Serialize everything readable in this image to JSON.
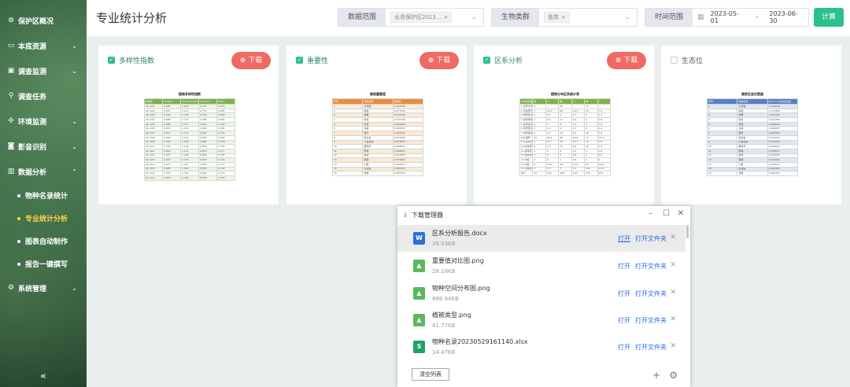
{
  "sidebar": {
    "items": [
      {
        "icon": "shield-icon",
        "glyph": "⊙",
        "label": "保护区概况",
        "chevron": false
      },
      {
        "icon": "layers-icon",
        "glyph": "▭",
        "label": "本底资源",
        "chevron": true
      },
      {
        "icon": "clipboard-icon",
        "glyph": "▣",
        "label": "调查监测",
        "chevron": true
      },
      {
        "icon": "search-icon",
        "glyph": "⚲",
        "label": "调查任务",
        "chevron": false
      },
      {
        "icon": "leaf-icon",
        "glyph": "✣",
        "label": "环境监测",
        "chevron": true
      },
      {
        "icon": "camera-icon",
        "glyph": "◙",
        "label": "影音识别",
        "chevron": true
      },
      {
        "icon": "chart-icon",
        "glyph": "▥",
        "label": "数据分析",
        "chevron": true
      }
    ],
    "sub_items": [
      {
        "label": "物种名录统计"
      },
      {
        "label": "专业统计分析"
      },
      {
        "label": "图表自动制作"
      },
      {
        "label": "报告一键撰写"
      }
    ],
    "system": {
      "icon": "gear-icon",
      "glyph": "⚙",
      "label": "系统管理"
    },
    "collapse_glyph": "«"
  },
  "header": {
    "title": "专业统计分析",
    "data_range": {
      "label": "数据范围",
      "tag": "长青保护区2023..."
    },
    "bio_group": {
      "label": "生物类群",
      "tag": "兽类"
    },
    "time_range": {
      "label": "时间范围",
      "start": "2023-05-01",
      "sep": "-",
      "end": "2023-06-30"
    },
    "calc_label": "计算"
  },
  "cards": [
    {
      "title": "多样性指数",
      "checked": true,
      "download": "下载",
      "thumb": {
        "title": "植物多样性指数",
        "header_color": "#7fb24a",
        "header": [
          "样地号",
          "Shapiro",
          "Shannon-Wiener",
          "Simpson",
          "Pielou"
        ],
        "rows": [
          [
            "Qlc-001",
            "2.685",
            "1.093",
            "0.724",
            "0.672"
          ],
          [
            "Qlc-002",
            "2.931",
            "1.112",
            "0.753",
            "0.695"
          ],
          [
            "Qlc-003",
            "3.100",
            "1.198",
            "0.756",
            "0.690"
          ],
          [
            "Qlc-004",
            "2.889",
            "1.107",
            "0.783",
            "0.697"
          ],
          [
            "Qlc-005",
            "2.988",
            "1.117",
            "0.803",
            "0.703"
          ],
          [
            "Qlc-006",
            "2.874",
            "1.165",
            "0.805",
            "0.695"
          ],
          [
            "Qlc-007",
            "2.851",
            "1.174",
            "0.803",
            "0.703"
          ],
          [
            "Qlc-008",
            "2.623",
            "1.115",
            "0.803",
            "0.697"
          ],
          [
            "Qlc-009",
            "2.720",
            "1.160",
            "0.804",
            "0.718"
          ],
          [
            "Qlc-010",
            "2.704",
            "1.158",
            "0.803",
            "0.723"
          ],
          [
            "Qlc-011",
            "2.846",
            "1.131",
            "0.833",
            "0.717"
          ],
          [
            "Qlc-012",
            "2.957",
            "1.093",
            "0.818",
            "0.705"
          ],
          [
            "Qlc-013",
            "2.807",
            "1.179",
            "0.823",
            "0.716"
          ],
          [
            "Qlc-014",
            "2.677",
            "1.181",
            "0.834",
            "0.711"
          ],
          [
            "Qlc-015",
            "2.695",
            "1.195",
            "0.830",
            "0.702"
          ],
          [
            "Qlc-016",
            "2.753",
            "1.212",
            "0.820",
            "0.719"
          ],
          [
            "Qlc-017",
            "2.830",
            "1.196",
            "0.818",
            "0.720"
          ]
        ]
      }
    },
    {
      "title": "重要性",
      "checked": true,
      "download": "下载",
      "thumb": {
        "title": "兽类重要值",
        "header_color": "#ef8b3c",
        "header": [
          "序号",
          "物种名称",
          "重要值"
        ],
        "rows": [
          [
            "1",
            "大熊猫",
            "0.123638"
          ],
          [
            "2",
            "猕猴",
            "0.077950"
          ],
          [
            "3",
            "林麝",
            "0.070330"
          ],
          [
            "4",
            "松鼠",
            "0.070330"
          ],
          [
            "5",
            "赤狐",
            "0.060664"
          ],
          [
            "6",
            "马鹿",
            "0.060687"
          ],
          [
            "7",
            "藏酋",
            "0.058295"
          ],
          [
            "8",
            "蒙古兔",
            "0.054233"
          ],
          [
            "9",
            "川金丝猴",
            "0.053653"
          ],
          [
            "10",
            "藏羚羊",
            "0.048651"
          ],
          [
            "11",
            "野猪",
            "0.048651"
          ],
          [
            "12",
            "猞猁",
            "0.047659"
          ],
          [
            "13",
            "豪猪",
            "0.047661"
          ],
          [
            "14",
            "小麂",
            "0.046512"
          ],
          [
            "15",
            "毛冠鹿",
            "0.046451"
          ],
          [
            "16",
            "赤麂",
            "0.046393"
          ]
        ]
      }
    },
    {
      "title": "区系分析",
      "checked": true,
      "download": "下载",
      "thumb": {
        "title": "植物分布区系统计表",
        "header_color": "#7fb24a",
        "header": [
          "分布区类型",
          "科",
          "%",
          "属",
          "%",
          "种",
          "%"
        ],
        "rows": [
          [
            "1.世界分布",
            "9",
            "—",
            "28",
            "—",
            "15",
            "—"
          ],
          [
            "2.泛热带分布",
            "7",
            "16.3",
            "64",
            "19.5",
            "35",
            "7.5"
          ],
          [
            "3.热带亚洲和热带美洲",
            "2",
            "4.7",
            "9",
            "2.7",
            "5",
            "1.1"
          ],
          [
            "4.旧世界热带",
            "1",
            "2.3",
            "11",
            "3.4",
            "4",
            "0.9"
          ],
          [
            "5.热带亚洲至热带大洋洲",
            "0",
            "0",
            "8",
            "2.4",
            "3",
            "0.6"
          ],
          [
            "6.热带亚洲至热带非洲",
            "1",
            "2.3",
            "9",
            "2.7",
            "2",
            "0.4"
          ],
          [
            "7.热带亚洲",
            "2",
            "4.7",
            "13",
            "4.0",
            "18",
            "3.9"
          ],
          [
            "8.北温带",
            "15",
            "34.9",
            "88",
            "26.8",
            "72",
            "15.4"
          ],
          [
            "9.东亚和北美洲间断",
            "4",
            "9.3",
            "35",
            "10.7",
            "13",
            "2.8"
          ],
          [
            "10.旧世界温带",
            "3",
            "7.0",
            "21",
            "6.4",
            "11",
            "2.4"
          ],
          [
            "11.温带亚洲",
            "0",
            "0",
            "4",
            "1.2",
            "3",
            "0.6"
          ],
          [
            "12.地中海区至中亚",
            "0",
            "0",
            "2",
            "0.6",
            "1",
            "0.2"
          ],
          [
            "13.中亚",
            "0",
            "0",
            "1",
            "0.3",
            "0",
            "0"
          ],
          [
            "14.东亚",
            "6",
            "14.0",
            "38",
            "11.6",
            "97",
            "20.8"
          ],
          [
            "15.中国特有",
            "2",
            "4.7",
            "7",
            "2.1",
            "195",
            "41.8"
          ],
          [
            "合计",
            "52",
            "100",
            "338",
            "100",
            "479",
            "100"
          ]
        ]
      }
    },
    {
      "title": "生态位",
      "checked": false,
      "download": "",
      "thumb": {
        "title": "兽类生态位宽度",
        "header_color": "#5b7fc7",
        "header": [
          "序号",
          "物种名称",
          "Shannon生态位宽度"
        ],
        "rows": [
          [
            "1",
            "大熊猫",
            "2.155618"
          ],
          [
            "2",
            "猕猴",
            "1.077950"
          ],
          [
            "3",
            "林麝",
            "1.070300"
          ],
          [
            "4",
            "松鼠",
            "1.070300"
          ],
          [
            "5",
            "赤狐",
            "1.060664"
          ],
          [
            "6",
            "马鹿",
            "1.060687"
          ],
          [
            "7",
            "藏酋",
            "0.858295"
          ],
          [
            "8",
            "蒙古兔",
            "0.754233"
          ],
          [
            "9",
            "川金丝猴",
            "0.553653"
          ],
          [
            "10",
            "藏羚羊",
            "0.248651"
          ],
          [
            "11",
            "野猪",
            "0.248651"
          ],
          [
            "12",
            "猞猁",
            "0.247659"
          ],
          [
            "13",
            "豪猪",
            "0.247661"
          ],
          [
            "14",
            "小麂",
            "0.246512"
          ],
          [
            "15",
            "毛冠鹿",
            "0.246451"
          ],
          [
            "16",
            "赤麂",
            "0.246393"
          ]
        ]
      }
    }
  ],
  "download_manager": {
    "title": "下载管理器",
    "files": [
      {
        "name": "区系分析报告.docx",
        "size": "38.03KB",
        "type": "W",
        "color": "#2a6fdb",
        "open": "打开",
        "open_folder": "打开文件夹"
      },
      {
        "name": "重要值对比图.png",
        "size": "28.18KB",
        "type": "▲",
        "color": "#5cb85c",
        "open": "打开",
        "open_folder": "打开文件夹"
      },
      {
        "name": "物种空间分布图.png",
        "size": "886.94KB",
        "type": "▲",
        "color": "#5cb85c",
        "open": "打开",
        "open_folder": "打开文件夹"
      },
      {
        "name": "植被类型.png",
        "size": "41.77KB",
        "type": "▲",
        "color": "#5cb85c",
        "open": "打开",
        "open_folder": "打开文件夹"
      },
      {
        "name": "物种名录20230529161140.xlsx",
        "size": "14.47KB",
        "type": "S",
        "color": "#21a366",
        "open": "打开",
        "open_folder": "打开文件夹"
      }
    ],
    "clear_label": "清空列表"
  }
}
